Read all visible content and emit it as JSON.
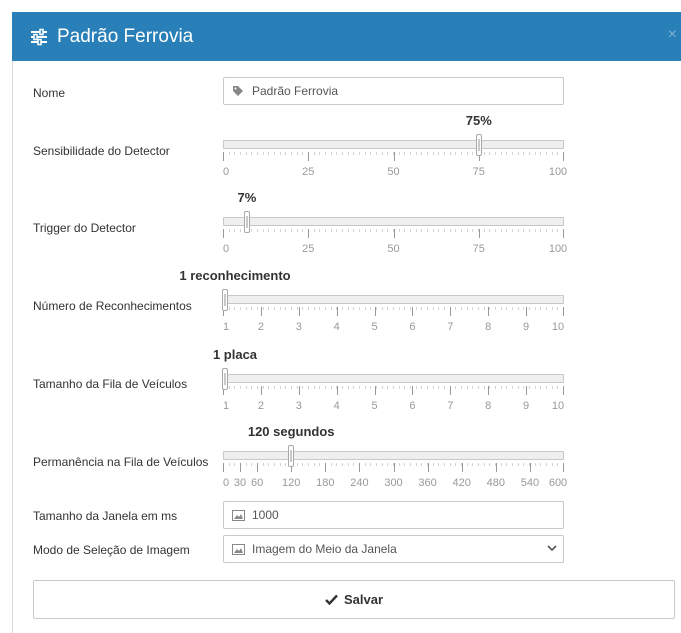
{
  "dialog": {
    "title": "Padrão Ferrovia",
    "title_icon": "sliders-icon",
    "close_label": "×",
    "accent": "#2980b9"
  },
  "fields": {
    "nome": {
      "label": "Nome",
      "value": "Padrão Ferrovia",
      "icon": "tag-icon"
    },
    "janela": {
      "label": "Tamanho da Janela em ms",
      "value": "1000",
      "icon": "image-icon"
    },
    "modo": {
      "label": "Modo de Seleção de Imagem",
      "value": "Imagem do Meio da Janela",
      "icon": "image-icon"
    }
  },
  "sliders": [
    {
      "key": "sensibilidade",
      "label": "Sensibilidade do Detector",
      "value_text": "75%",
      "value": 75,
      "min": 0,
      "max": 100,
      "tick_labels": [
        "0",
        "25",
        "50",
        "75",
        "100"
      ],
      "tick_values": [
        0,
        25,
        50,
        75,
        100
      ]
    },
    {
      "key": "trigger",
      "label": "Trigger do Detector",
      "value_text": "7%",
      "value": 7,
      "min": 0,
      "max": 100,
      "tick_labels": [
        "0",
        "25",
        "50",
        "75",
        "100"
      ],
      "tick_values": [
        0,
        25,
        50,
        75,
        100
      ]
    },
    {
      "key": "reconhecimentos",
      "label": "Número de Reconhecimentos",
      "value_text": "1 reconhecimento",
      "value": 1,
      "min": 1,
      "max": 10,
      "tick_labels": [
        "1",
        "2",
        "3",
        "4",
        "5",
        "6",
        "7",
        "8",
        "9",
        "10"
      ],
      "tick_values": [
        1,
        2,
        3,
        4,
        5,
        6,
        7,
        8,
        9,
        10
      ]
    },
    {
      "key": "fila",
      "label": "Tamanho da Fila de Veículos",
      "value_text": "1 placa",
      "value": 1,
      "min": 1,
      "max": 10,
      "tick_labels": [
        "1",
        "2",
        "3",
        "4",
        "5",
        "6",
        "7",
        "8",
        "9",
        "10"
      ],
      "tick_values": [
        1,
        2,
        3,
        4,
        5,
        6,
        7,
        8,
        9,
        10
      ]
    },
    {
      "key": "permanencia",
      "label": "Permanência na Fila de Veículos",
      "value_text": "120 segundos",
      "value": 120,
      "min": 0,
      "max": 600,
      "tick_labels": [
        "0",
        "30",
        "60",
        "120",
        "180",
        "240",
        "300",
        "360",
        "420",
        "480",
        "540",
        "600"
      ],
      "tick_values": [
        0,
        30,
        60,
        120,
        180,
        240,
        300,
        360,
        420,
        480,
        540,
        600
      ]
    }
  ],
  "save": {
    "label": "Salvar",
    "icon": "check-icon"
  }
}
